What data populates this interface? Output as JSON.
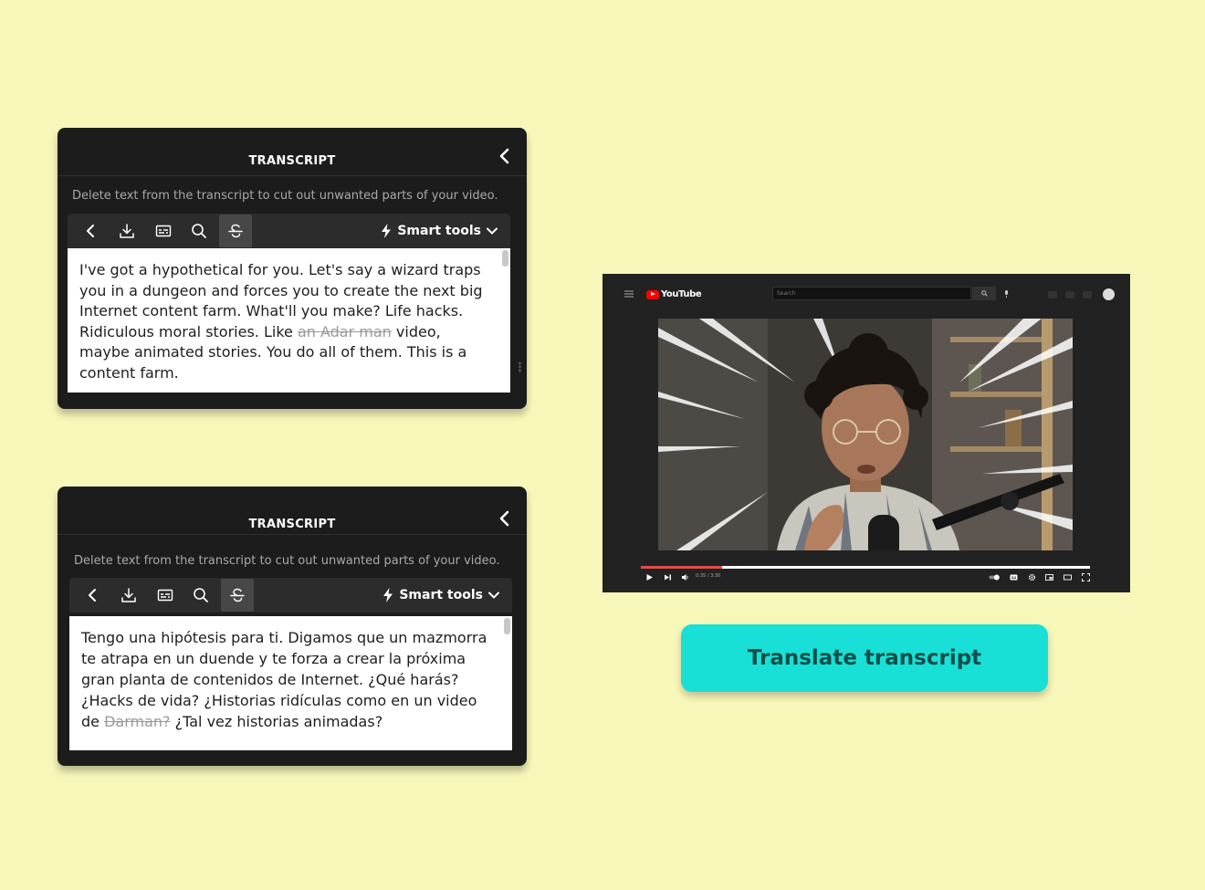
{
  "transcript_panels": [
    {
      "title": "TRANSCRIPT",
      "description": "Delete text from the transcript to cut out unwanted parts of your video.",
      "smart_tools_label": "Smart tools",
      "text_before": "I've got a hypothetical for you. Let's say a wizard traps you in a dungeon and forces you to create the next big Internet content farm. What'll you make? Life hacks. Ridiculous moral stories. Like ",
      "text_struck": "an Adar man",
      "text_after": " video, maybe animated stories. You do all of them. This is a content farm."
    },
    {
      "title": "TRANSCRIPT",
      "description": "Delete text from the transcript to cut out unwanted parts of your video.",
      "smart_tools_label": "Smart tools",
      "text_before": "Tengo una hipótesis para ti. Digamos que un mazmorra te atrapa en un duende y te forza a crear la próxima gran planta de contenidos de Internet. ¿Qué harás? ¿Hacks de vida? ¿Historias ridículas como en un video de ",
      "text_struck": "Darman?",
      "text_after": " ¿Tal vez historias animadas?"
    }
  ],
  "toolbar_icons": [
    "back-icon",
    "download-icon",
    "subtitles-icon",
    "search-icon",
    "strikethrough-icon"
  ],
  "player": {
    "logo_text": "YouTube",
    "search_placeholder": "Search",
    "time": "0:35 / 3:30",
    "progress_fraction": 0.18
  },
  "translate_button_label": "Translate transcript",
  "colors": {
    "background": "#f7f7b9",
    "panel": "#1c1c1c",
    "button": "#19e0d6",
    "button_text": "#0f4f4a",
    "progress": "#e24b4b"
  }
}
